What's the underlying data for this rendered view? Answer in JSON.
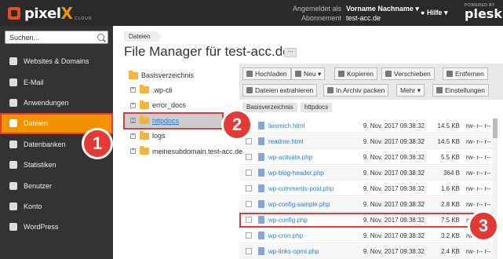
{
  "header": {
    "logo_text": "pixel",
    "logo_x": "X",
    "logo_sub": "CLOUD",
    "account_label_1": "Angemeldet als",
    "account_value_1": "Vorname Nachname ▾",
    "account_label_2": "Abonnement",
    "account_value_2": "test-acc.de",
    "help": "Hilfe ▾",
    "powered_by": "POWERED BY",
    "plesk": "plesk",
    "colors": {
      "bar": "#2a2a2a",
      "accent": "#f39200"
    }
  },
  "sidebar": {
    "search_placeholder": "Suchen...",
    "items": [
      {
        "label": "Websites & Domains",
        "icon": "globe-icon"
      },
      {
        "label": "E-Mail",
        "icon": "mail-icon"
      },
      {
        "label": "Anwendungen",
        "icon": "gear-icon"
      },
      {
        "label": "Dateien",
        "icon": "folder-icon",
        "active": true
      },
      {
        "label": "Datenbanken",
        "icon": "database-icon"
      },
      {
        "label": "Statistiken",
        "icon": "bar-chart-icon"
      },
      {
        "label": "Benutzer",
        "icon": "user-icon"
      },
      {
        "label": "Konto",
        "icon": "account-icon"
      },
      {
        "label": "WordPress",
        "icon": "wordpress-icon"
      }
    ]
  },
  "main": {
    "breadcrumb": "Dateien",
    "title": "File Manager für test-acc.de",
    "title_more": "···"
  },
  "tree": {
    "root": "Basisverzeichnis",
    "items": [
      ".wp-cli",
      "error_docs",
      "httpdocs",
      "logs",
      "meinesubdomain.test-acc.de"
    ]
  },
  "toolbar": {
    "upload": "Hochladen",
    "new": "Neu ▾",
    "copy": "Kopieren",
    "move": "Verschieben",
    "remove": "Entfernen",
    "extract": "Dateien extrahieren",
    "archive": "In Archiv packen",
    "more": "Mehr ▾",
    "settings": "Einstellungen"
  },
  "path": {
    "seg1": "Basisverzeichnis",
    "seg2": "httpdocs"
  },
  "files": [
    {
      "name": "liesmich.html",
      "date": "9. Nov. 2017 09:38:32",
      "size": "14.5 KB",
      "perm": "rw- r-- r--"
    },
    {
      "name": "readme.html",
      "date": "9. Nov. 2017 09:38:32",
      "size": "14.5 KB",
      "perm": "rw- r-- r--"
    },
    {
      "name": "wp-activate.php",
      "date": "9. Nov. 2017 09:38:32",
      "size": "5.5 KB",
      "perm": "rw- r-- r--"
    },
    {
      "name": "wp-blog-header.php",
      "date": "9. Nov. 2017 09:38:32",
      "size": "364 B",
      "perm": "rw- r-- r--"
    },
    {
      "name": "wp-comments-post.php",
      "date": "9. Nov. 2017 09:38:32",
      "size": "1.6 KB",
      "perm": "rw- r-- r--"
    },
    {
      "name": "wp-config-sample.php",
      "date": "9. Nov. 2017 09:38:32",
      "size": "2.8 KB",
      "perm": "rw- r-- r--"
    },
    {
      "name": "wp-config.php",
      "date": "9. Nov. 2017 09:38:32",
      "size": "7.5 KB",
      "perm": "rw-"
    },
    {
      "name": "wp-cron.php",
      "date": "9. Nov. 2017 09:38:32",
      "size": "3.2 KB",
      "perm": "rw- r-- r--"
    },
    {
      "name": "wp-links-opml.php",
      "date": "9. Nov. 2017 09:38:32",
      "size": "2.4 KB",
      "perm": "rw- r-- r--"
    }
  ],
  "badges": [
    "1",
    "2",
    "3"
  ]
}
